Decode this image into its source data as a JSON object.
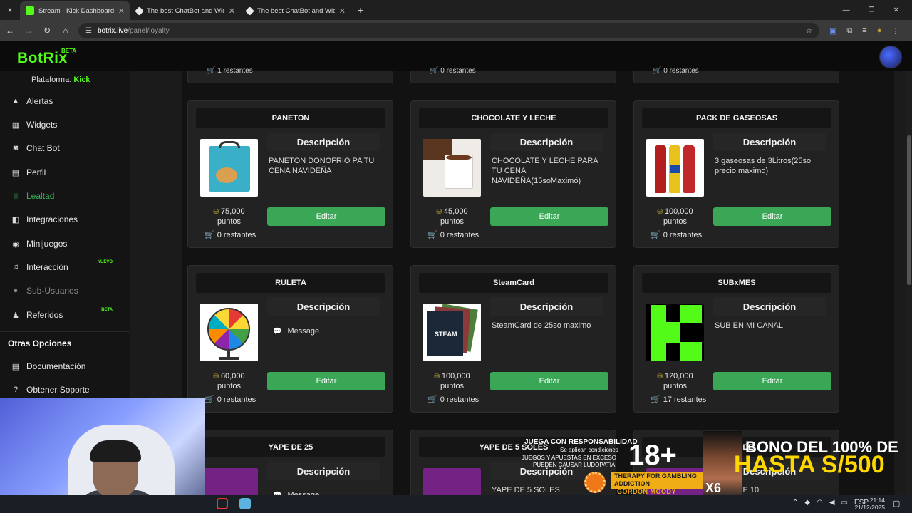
{
  "browser": {
    "tabs": [
      {
        "title": "Stream - Kick Dashboard",
        "color": "#53fc18"
      },
      {
        "title": "The best ChatBot and Widgets",
        "color": "#ffffff"
      },
      {
        "title": "The best ChatBot and Widgets",
        "color": "#ffffff"
      }
    ],
    "url_host": "botrix.live",
    "url_path": "/panel/loyalty"
  },
  "app": {
    "logo": "BotRix",
    "logo_badge": "BETA",
    "platform_label": "Plataforma:",
    "platform_value": "Kick",
    "accent_color": "#53fc18"
  },
  "sidebar": {
    "items": [
      {
        "label": "Alertas",
        "icon": "warning-icon"
      },
      {
        "label": "Widgets",
        "icon": "grid-icon"
      },
      {
        "label": "Chat Bot",
        "icon": "robot-icon"
      },
      {
        "label": "Perfil",
        "icon": "id-card-icon"
      },
      {
        "label": "Lealtad",
        "icon": "trophy-icon"
      },
      {
        "label": "Integraciones",
        "icon": "plug-icon"
      },
      {
        "label": "Minijuegos",
        "icon": "gamepad-icon"
      },
      {
        "label": "Interacción",
        "icon": "music-icon",
        "badge": "NUEVO"
      },
      {
        "label": "Sub-Usuarios",
        "icon": "user-lock-icon"
      },
      {
        "label": "Referidos",
        "icon": "users-icon",
        "badge": "BETA"
      }
    ],
    "section_title": "Otras Opciones",
    "other_items": [
      {
        "label": "Documentación",
        "icon": "book-icon"
      },
      {
        "label": "Obtener Soporte",
        "icon": "question-icon"
      }
    ]
  },
  "top_row_remaining": [
    "1 restantes",
    "0 restantes",
    "0 restantes"
  ],
  "cards": [
    {
      "title": "PANETON",
      "desc_heading": "Descripción",
      "description": "PANETON DONOFRIO PA TU CENA NAVIDEÑA",
      "points": "75,000",
      "points_unit": "puntos",
      "remaining": "0 restantes",
      "edit": "Editar"
    },
    {
      "title": "CHOCOLATE Y LECHE",
      "desc_heading": "Descripción",
      "description": "CHOCOLATE Y LECHE PARA TU CENA NAVIDEÑA(15soMaximó)",
      "points": "45,000",
      "points_unit": "puntos",
      "remaining": "0 restantes",
      "edit": "Editar"
    },
    {
      "title": "PACK DE GASEOSAS",
      "desc_heading": "Descripción",
      "description": "3 gaseosas de 3Litros(25so precio maximo)",
      "points": "100,000",
      "points_unit": "puntos",
      "remaining": "0 restantes",
      "edit": "Editar"
    },
    {
      "title": "RULETA",
      "desc_heading": "Descripción",
      "description": "Message",
      "points": "60,000",
      "points_unit": "puntos",
      "remaining": "0 restantes",
      "edit": "Editar"
    },
    {
      "title": "SteamCard",
      "desc_heading": "Descripción",
      "description": "SteamCard de 25so maximo",
      "points": "100,000",
      "points_unit": "puntos",
      "remaining": "0 restantes",
      "edit": "Editar"
    },
    {
      "title": "SUBxMES",
      "desc_heading": "Descripción",
      "description": "SUB EN MI CANAL",
      "points": "120,000",
      "points_unit": "puntos",
      "remaining": "17 restantes",
      "edit": "Editar"
    },
    {
      "title": "YAPE DE 25",
      "desc_heading": "Descripción",
      "description": "Message"
    },
    {
      "title": "YAPE DE 5 SOLES",
      "desc_heading": "Descripción",
      "description": "YAPE DE 5 SOLES"
    },
    {
      "title": "YAPE DE",
      "desc_heading": "Descripción",
      "description": "YAPE DE 10"
    }
  ],
  "promo": {
    "line1": "JUEGA CON RESPONSABILIDAD",
    "line2": "Se aplican condiciones",
    "line3": "JUEGOS Y APUESTAS EN EXCESO",
    "line4": "PUEDEN CAUSAR LUDOPATÍA",
    "age": "18+",
    "therapy": "THERAPY FOR GAMBLING ADDICTION",
    "gordon": "GORDON MOODY",
    "bono": "BONO DEL 100% DE",
    "hasta": "HASTA S/500",
    "multiplier": "X6"
  },
  "taskbar": {
    "lang": "ESP",
    "time": "21:14",
    "date": "21/12/2025"
  }
}
